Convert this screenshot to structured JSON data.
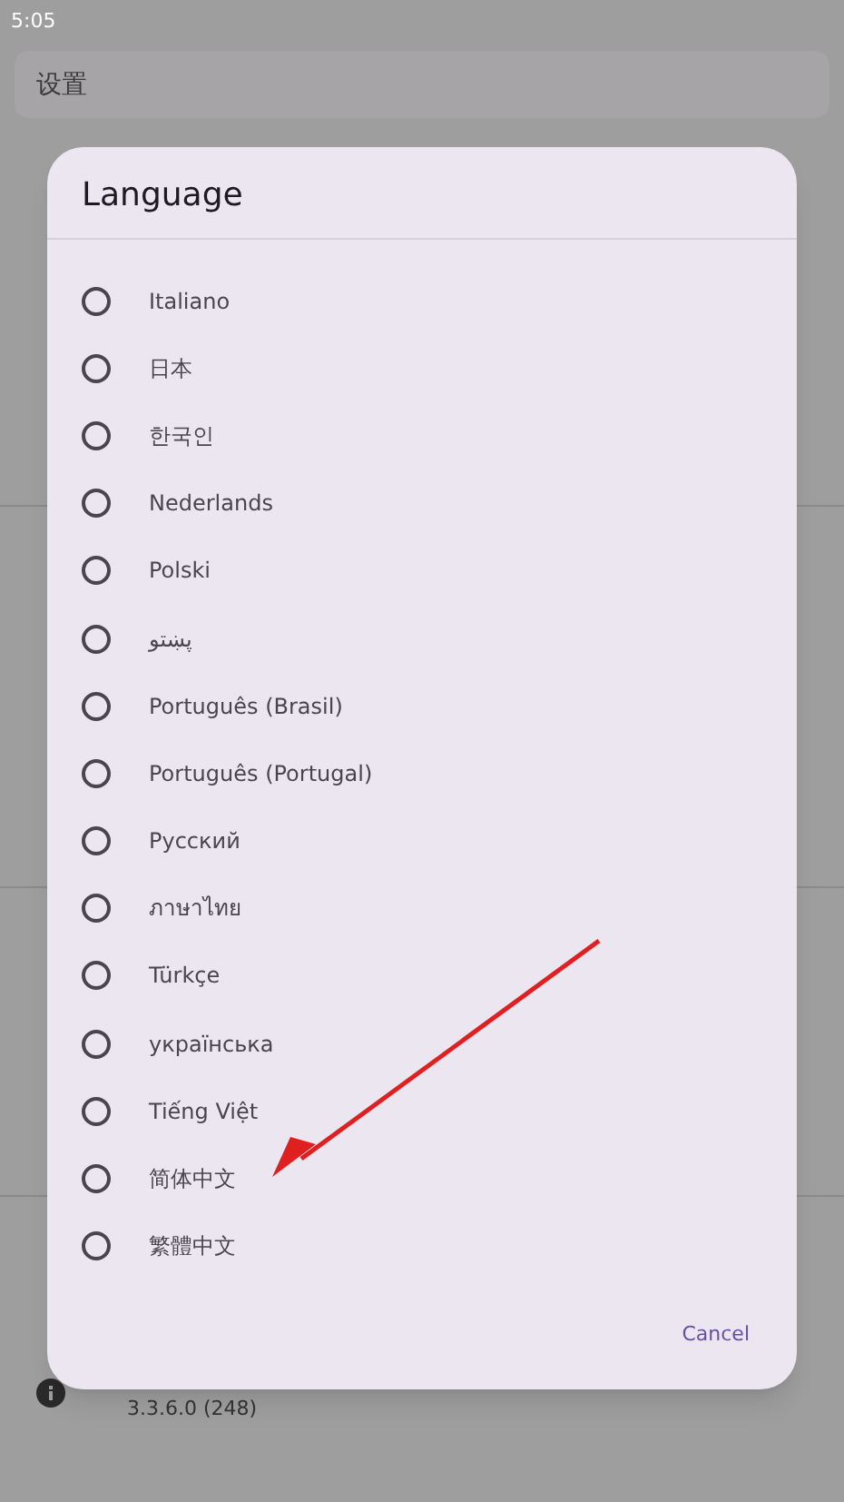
{
  "status_bar": {
    "time": "5:05"
  },
  "search": {
    "placeholder": "设置"
  },
  "about": {
    "version": "3.3.6.0 (248)"
  },
  "dialog": {
    "title": "Language",
    "options": [
      {
        "label": "Italiano",
        "selected": false
      },
      {
        "label": "日本",
        "selected": false
      },
      {
        "label": "한국인",
        "selected": false
      },
      {
        "label": "Nederlands",
        "selected": false
      },
      {
        "label": "Polski",
        "selected": false
      },
      {
        "label": "پښتو",
        "selected": false
      },
      {
        "label": "Português (Brasil)",
        "selected": false
      },
      {
        "label": "Português (Portugal)",
        "selected": false
      },
      {
        "label": "Русский",
        "selected": false
      },
      {
        "label": "ภาษาไทย",
        "selected": false
      },
      {
        "label": "Türkçe",
        "selected": false
      },
      {
        "label": "українська",
        "selected": false
      },
      {
        "label": "Tiếng Việt",
        "selected": false
      },
      {
        "label": "简体中文",
        "selected": false
      },
      {
        "label": "繁體中文",
        "selected": false
      }
    ],
    "buttons": [
      "Cancel"
    ]
  }
}
